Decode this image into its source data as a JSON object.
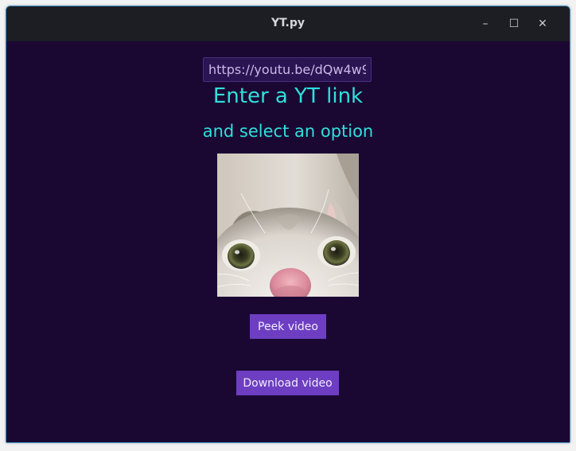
{
  "window": {
    "title": "YT.py",
    "controls": {
      "minimize": "–",
      "maximize": "☐",
      "close": "✕"
    }
  },
  "form": {
    "url_value": "https://youtu.be/dQw4w9",
    "heading": "Enter a YT link",
    "subheading": "and select an option"
  },
  "thumbnail": {
    "icon": "cat-photo"
  },
  "buttons": {
    "peek": "Peek video",
    "download": "Download video"
  },
  "colors": {
    "background": "#1a0833",
    "accent_text": "#2fe0dc",
    "button": "#6d3ec2"
  }
}
